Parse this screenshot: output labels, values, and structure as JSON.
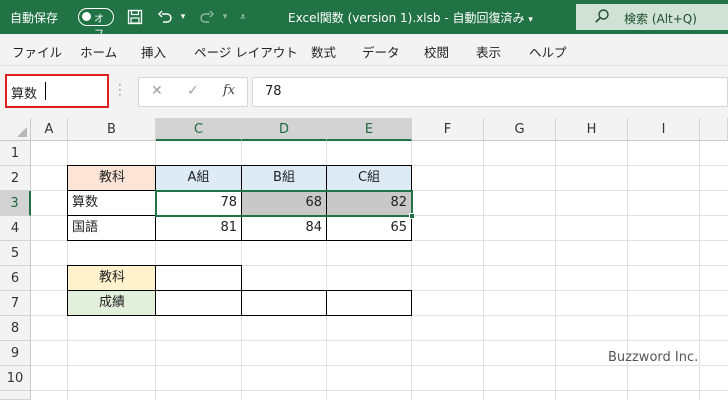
{
  "titlebar": {
    "autosave_label": "自動保存",
    "toggle_state": "オフ",
    "document_title": "Excel関数 (version 1).xlsb",
    "save_status": "自動回復済み",
    "search_text": "検索 (Alt+Q)"
  },
  "menu": [
    "ファイル",
    "ホーム",
    "挿入",
    "ページ レイアウト",
    "数式",
    "データ",
    "校閲",
    "表示",
    "ヘルプ"
  ],
  "formula_bar": {
    "name_box": "算数",
    "formula": "78"
  },
  "columns": [
    "A",
    "B",
    "C",
    "D",
    "E",
    "F",
    "G",
    "H",
    "I"
  ],
  "rows": [
    "1",
    "2",
    "3",
    "4",
    "5",
    "6",
    "7",
    "8",
    "9",
    "10"
  ],
  "table": {
    "header": [
      "教科",
      "A組",
      "B組",
      "C組"
    ],
    "rows": [
      {
        "subject": "算数",
        "a": "78",
        "b": "68",
        "c": "82"
      },
      {
        "subject": "国語",
        "a": "81",
        "b": "84",
        "c": "65"
      }
    ]
  },
  "lookup": {
    "subject_label": "教科",
    "score_label": "成績"
  },
  "watermark": "Buzzword Inc.",
  "colors": {
    "excel_green": "#217346",
    "header_fill_subject": "#fce4d6",
    "header_fill_group": "#ddebf7",
    "lookup_subject_fill": "#fff2cc",
    "lookup_score_fill": "#e2efda",
    "highlight_gray": "#c8c8c8",
    "namebox_border": "#e02020"
  }
}
